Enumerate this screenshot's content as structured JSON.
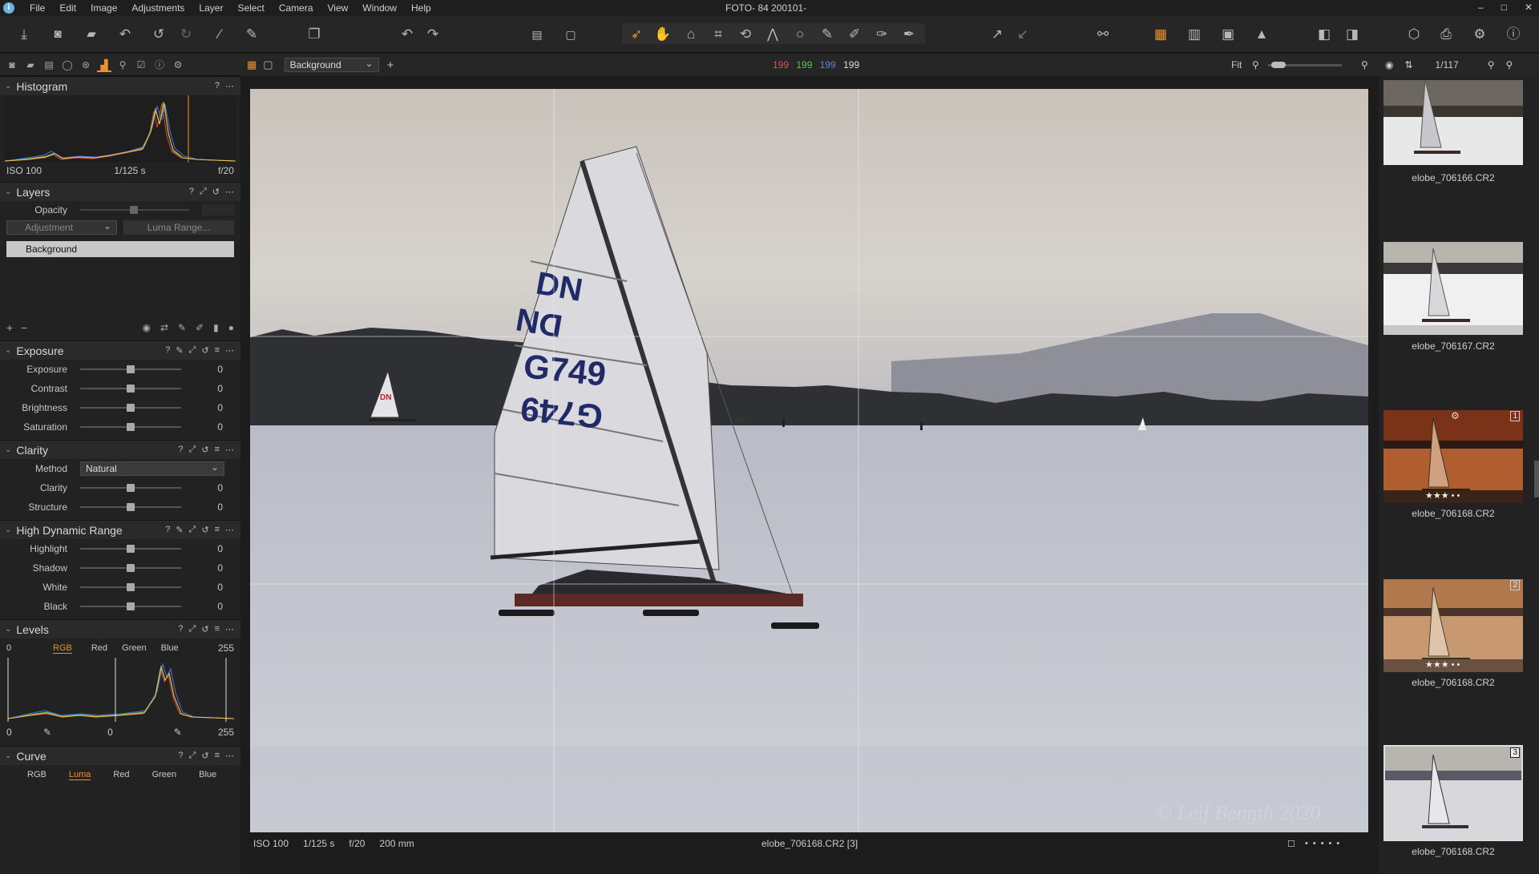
{
  "app": {
    "title": "FOTO- 84 200101-",
    "menu": [
      "File",
      "Edit",
      "Image",
      "Adjustments",
      "Layer",
      "Select",
      "Camera",
      "View",
      "Window",
      "Help"
    ],
    "window_controls": [
      "–",
      "□",
      "✕"
    ]
  },
  "viewer": {
    "layer_select": "Background",
    "rgb_readout": {
      "r": "199",
      "g": "199",
      "b": "199",
      "l": "199"
    },
    "zoom": "Fit",
    "counter": "1/117",
    "status": {
      "iso": "ISO 100",
      "shutter": "1/125 s",
      "aperture": "f/20",
      "focal": "200 mm",
      "filename": "elobe_706168.CR2 [3]"
    },
    "watermark": "© Leif Bength 2020"
  },
  "histogram": {
    "title": "Histogram",
    "iso": "ISO 100",
    "shutter": "1/125 s",
    "aperture": "f/20"
  },
  "layers": {
    "title": "Layers",
    "opacity_label": "Opacity",
    "adjustment_label": "Adjustment",
    "luma_label": "Luma Range...",
    "items": [
      "Background"
    ]
  },
  "exposure": {
    "title": "Exposure",
    "rows": [
      {
        "label": "Exposure",
        "value": "0"
      },
      {
        "label": "Contrast",
        "value": "0"
      },
      {
        "label": "Brightness",
        "value": "0"
      },
      {
        "label": "Saturation",
        "value": "0"
      }
    ]
  },
  "clarity": {
    "title": "Clarity",
    "method_label": "Method",
    "method_value": "Natural",
    "rows": [
      {
        "label": "Clarity",
        "value": "0"
      },
      {
        "label": "Structure",
        "value": "0"
      }
    ]
  },
  "hdr": {
    "title": "High Dynamic Range",
    "rows": [
      {
        "label": "Highlight",
        "value": "0"
      },
      {
        "label": "Shadow",
        "value": "0"
      },
      {
        "label": "White",
        "value": "0"
      },
      {
        "label": "Black",
        "value": "0"
      }
    ]
  },
  "levels": {
    "title": "Levels",
    "low": "0",
    "high": "255",
    "channels": [
      "RGB",
      "Red",
      "Green",
      "Blue"
    ],
    "out_low": "0",
    "mid": "0",
    "out_high": "255"
  },
  "curve": {
    "title": "Curve",
    "channels": [
      "RGB",
      "Luma",
      "Red",
      "Green",
      "Blue"
    ]
  },
  "thumbnails": [
    {
      "name": "elobe_706166.CR2",
      "badge": ""
    },
    {
      "name": "elobe_706167.CR2",
      "badge": ""
    },
    {
      "name": "elobe_706168.CR2",
      "badge": "1"
    },
    {
      "name": "elobe_706168.CR2",
      "badge": "2"
    },
    {
      "name": "elobe_706168.CR2",
      "badge": "3"
    }
  ],
  "sail": {
    "top": "DN",
    "mid": "DN",
    "num1": "G749",
    "num2": "G749"
  },
  "sail2": {
    "text": "DN"
  },
  "colors": {
    "accent": "#f0902a",
    "panel": "#222222",
    "red": "#e05050",
    "green": "#60c060",
    "blue": "#6080e0"
  }
}
